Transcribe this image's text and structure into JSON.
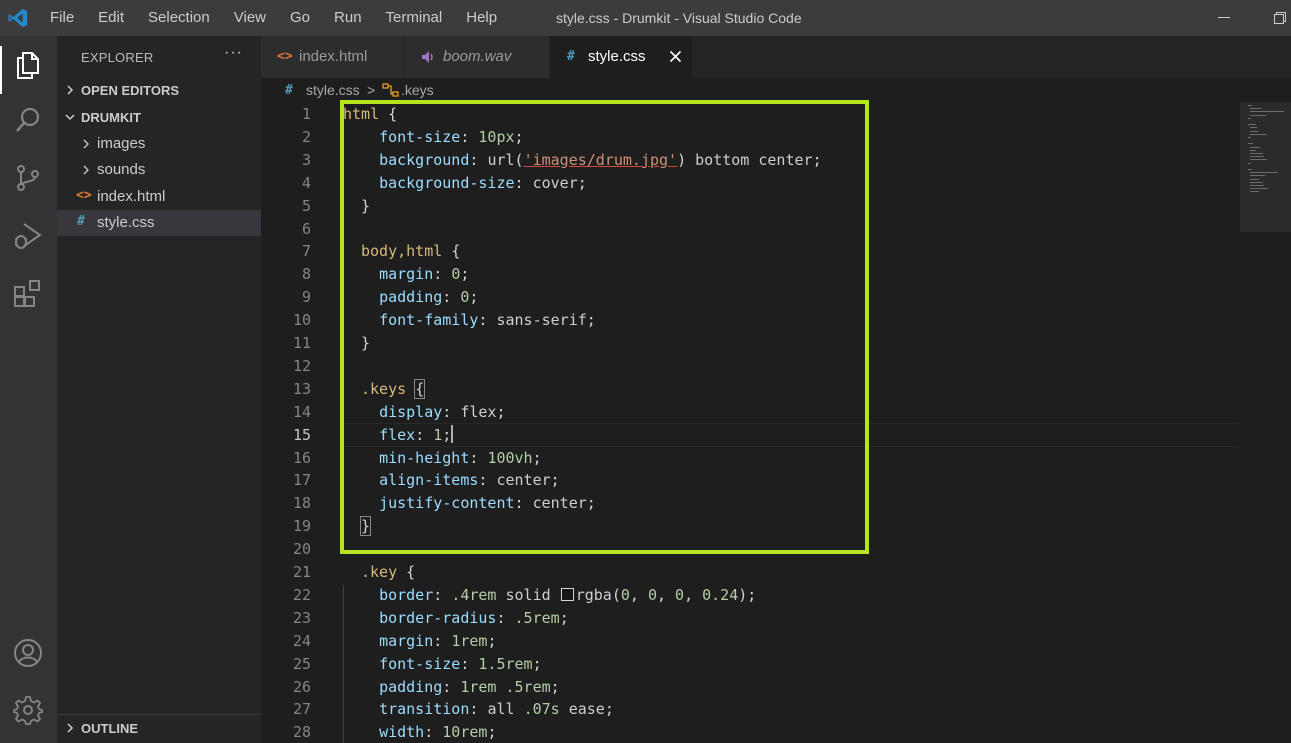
{
  "window": {
    "title": "style.css - Drumkit - Visual Studio Code",
    "menu": [
      "File",
      "Edit",
      "Selection",
      "View",
      "Go",
      "Run",
      "Terminal",
      "Help"
    ]
  },
  "activity_bar": {
    "icons": [
      "files-icon",
      "search-icon",
      "source-control-icon",
      "run-debug-icon",
      "extensions-icon",
      "account-icon",
      "settings-gear-icon"
    ]
  },
  "sidebar": {
    "title": "EXPLORER",
    "more": "···",
    "open_editors": "OPEN EDITORS",
    "folder": "DRUMKIT",
    "items": [
      {
        "label": "images",
        "type": "folder"
      },
      {
        "label": "sounds",
        "type": "folder"
      },
      {
        "label": "index.html",
        "type": "html",
        "icon": "<>"
      },
      {
        "label": "style.css",
        "type": "css",
        "icon": "#"
      }
    ],
    "outline": "OUTLINE"
  },
  "tabs": [
    {
      "label": "index.html",
      "icon": "<>"
    },
    {
      "label": "boom.wav",
      "icon": "speaker"
    },
    {
      "label": "style.css",
      "icon": "#"
    }
  ],
  "breadcrumb": {
    "file_icon": "#",
    "file": "style.css",
    "separator": ">",
    "symbol": ".keys"
  },
  "editor": {
    "current_line": 15,
    "lines": [
      {
        "n": "1",
        "t": "html {"
      },
      {
        "n": "2",
        "t": "  font-size: 10px;"
      },
      {
        "n": "3",
        "t": "  background: url('images/drum.jpg') bottom center;"
      },
      {
        "n": "4",
        "t": "  background-size: cover;"
      },
      {
        "n": "5",
        "t": "}"
      },
      {
        "n": "6",
        "t": ""
      },
      {
        "n": "7",
        "t": "body,html {"
      },
      {
        "n": "8",
        "t": "  margin: 0;"
      },
      {
        "n": "9",
        "t": "  padding: 0;"
      },
      {
        "n": "10",
        "t": "  font-family: sans-serif;"
      },
      {
        "n": "11",
        "t": "}"
      },
      {
        "n": "12",
        "t": ""
      },
      {
        "n": "13",
        "t": ".keys {"
      },
      {
        "n": "14",
        "t": "  display: flex;"
      },
      {
        "n": "15",
        "t": "  flex: 1;"
      },
      {
        "n": "16",
        "t": "  min-height: 100vh;"
      },
      {
        "n": "17",
        "t": "  align-items: center;"
      },
      {
        "n": "18",
        "t": "  justify-content: center;"
      },
      {
        "n": "19",
        "t": "}"
      },
      {
        "n": "20",
        "t": ""
      },
      {
        "n": "21",
        "t": ".key {"
      },
      {
        "n": "22",
        "t": "  border: .4rem solid rgba(0, 0, 0, 0.24);"
      },
      {
        "n": "23",
        "t": "  border-radius: .5rem;"
      },
      {
        "n": "24",
        "t": "  margin: 1rem;"
      },
      {
        "n": "25",
        "t": "  font-size: 1.5rem;"
      },
      {
        "n": "26",
        "t": "  padding: 1rem .5rem;"
      },
      {
        "n": "27",
        "t": "  transition: all .07s ease;"
      },
      {
        "n": "28",
        "t": "  width: 10rem;"
      }
    ]
  },
  "colors": {
    "highlight_box": "#b5e61d",
    "selector": "#d7ba7d",
    "property": "#9cdcfe",
    "number": "#b5cea8",
    "string": "#ce9178",
    "css_icon": "#519aba",
    "html_icon": "#e37933",
    "wav_icon": "#a074c4"
  }
}
